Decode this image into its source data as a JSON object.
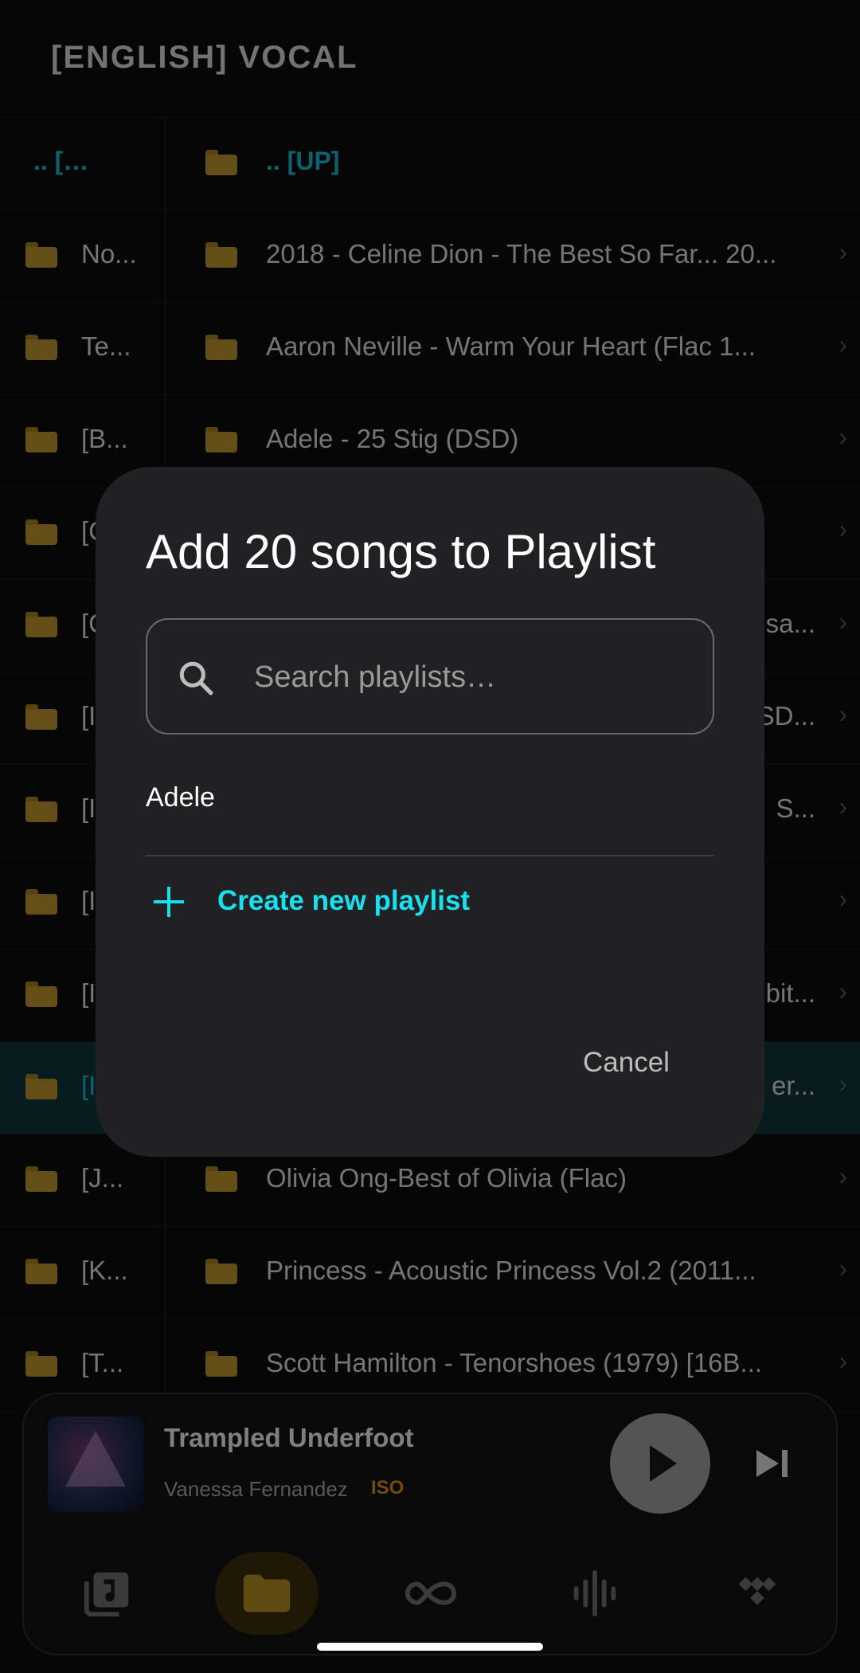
{
  "header": {
    "title": "[ENGLISH] VOCAL"
  },
  "left_list": {
    "up_label": ".. [UP]",
    "items": [
      "No...",
      "Te...",
      "[B...",
      "[C...",
      "[C...",
      "[I...",
      "[I...",
      "[I...",
      "[I...",
      "[I...",
      "[J...",
      "[K...",
      "[T..."
    ]
  },
  "right_list": {
    "up_label": ".. [UP]",
    "items": [
      "2018 - Celine Dion - The Best So Far... 20...",
      "Aaron Neville - Warm Your Heart (Flac 1...",
      "Adele - 25 Stig (DSD)",
      "",
      "sa...",
      "SD...",
      "S...",
      "",
      "bit...",
      "er...",
      "Olivia Ong-Best of Olivia (Flac)",
      "Princess - Acoustic Princess Vol.2 (2011...",
      "Scott Hamilton - Tenorshoes (1979) [16B..."
    ]
  },
  "player": {
    "title": "Trampled Underfoot",
    "artist": "Vanessa Fernandez",
    "format_badge": "ISO"
  },
  "nav": {
    "items": [
      "music-library-icon",
      "folder-icon",
      "infinity-icon",
      "waveform-icon",
      "tidal-icon"
    ],
    "active": "folder-icon"
  },
  "dialog": {
    "title": "Add 20 songs to Playlist",
    "search_placeholder": "Search playlists…",
    "playlists": [
      "Adele"
    ],
    "create_label": "Create new playlist",
    "cancel_label": "Cancel"
  },
  "colors": {
    "accent": "#18E0EF",
    "folder": "#B38F28",
    "badge": "#D28A14",
    "dialog_bg": "#212123"
  }
}
